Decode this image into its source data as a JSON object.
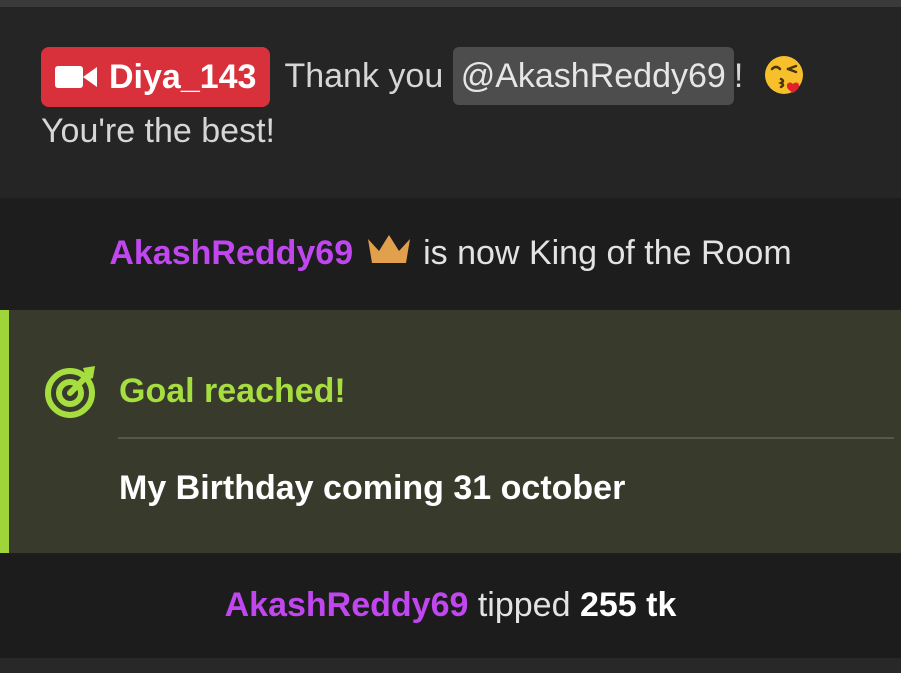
{
  "message": {
    "sender": "Diya_143",
    "sender_icon": "video-camera-icon",
    "text_before": "Thank you",
    "mention": "@AkashReddy69",
    "text_after": "!",
    "emoji": "face-blowing-kiss-emoji",
    "line2": "You're the best!",
    "badge_color": "#d9313b"
  },
  "king": {
    "user": "AkashReddy69",
    "icon": "crown-icon",
    "text": "is now King of the Room"
  },
  "goal": {
    "icon": "target-icon",
    "title": "Goal reached!",
    "description": "My Birthday coming 31 october",
    "accent": "#9fd53a"
  },
  "tip": {
    "user": "AkashReddy69",
    "verb": "tipped",
    "amount": "255 tk"
  },
  "colors": {
    "username": "#c046f0",
    "goal_bg": "#383b2c"
  }
}
